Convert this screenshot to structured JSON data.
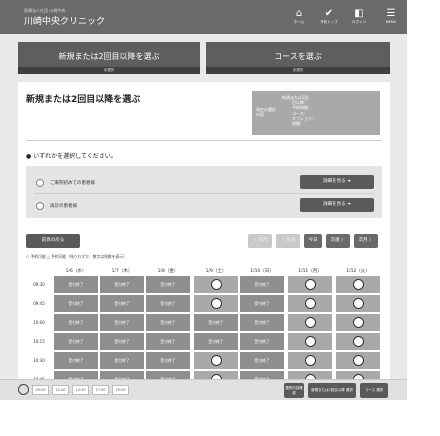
{
  "header": {
    "clinic_sub": "医療法人社団 川崎中央",
    "clinic_name": "川崎中央クリニック",
    "nav": [
      {
        "icon": "home-icon",
        "glyph": "⌂",
        "label": "ホーム"
      },
      {
        "icon": "check-icon",
        "glyph": "✔",
        "label": "予約トップ"
      },
      {
        "icon": "login-icon",
        "glyph": "◧",
        "label": "ログイン"
      },
      {
        "icon": "menu-icon",
        "glyph": "☰",
        "label": "MENU"
      }
    ]
  },
  "steps": [
    {
      "title": "新規または2回目以降を選ぶ",
      "status": "未選択"
    },
    {
      "title": "コースを選ぶ",
      "status": "未選択"
    }
  ],
  "panel": {
    "title": "新規または2回目以降を選ぶ",
    "selection": {
      "heading": "現在の選択内容",
      "rows": [
        "新規または2回",
        "目以降：",
        "予約時間：",
        "コース：",
        "オプション：",
        "総額："
      ]
    },
    "prompt": "● いずれかを選択してください。",
    "options": [
      {
        "label": "ご来院初めての患者様",
        "button": "詳細を見る ➜"
      },
      {
        "label": "再診の患者様",
        "button": "詳細を見る ➜"
      }
    ]
  },
  "toolbar": {
    "back": "前頁の戻る",
    "nav": [
      {
        "label": "〈 前月",
        "enabled": false
      },
      {
        "label": "〈 前週",
        "enabled": false
      },
      {
        "label": "今日",
        "enabled": true
      },
      {
        "label": "次週 〉",
        "enabled": true
      },
      {
        "label": "次月 〉",
        "enabled": true
      }
    ]
  },
  "legend": "○ 予約可能 △ 予約可能（残りわずか、数字は残数を表示）",
  "schedule": {
    "dates": [
      "1/6（水）",
      "1/7（木）",
      "1/8（金）",
      "1/9（土）",
      "1/10（日）",
      "1/11（月）",
      "1/12（火）"
    ],
    "times": [
      "09:30",
      "09:45",
      "10:00",
      "10:15",
      "10:30",
      "10:45"
    ],
    "closed_label": "受付終了",
    "rows": [
      [
        "受付終了",
        "受付終了",
        "受付終了",
        "○",
        "受付終了",
        "○",
        "○"
      ],
      [
        "受付終了",
        "受付終了",
        "受付終了",
        "○",
        "受付終了",
        "○",
        "○"
      ],
      [
        "受付終了",
        "受付終了",
        "受付終了",
        "受付終了",
        "受付終了",
        "○",
        "○"
      ],
      [
        "受付終了",
        "受付終了",
        "受付終了",
        "受付終了",
        "受付終了",
        "○",
        "○"
      ],
      [
        "受付終了",
        "受付終了",
        "受付終了",
        "○",
        "受付終了",
        "○",
        "○"
      ],
      [
        "受付終了",
        "受付終了",
        "受付終了",
        "○",
        "受付終了",
        "○",
        "○"
      ]
    ]
  },
  "bottom": {
    "times": [
      "09:00",
      "12:00",
      "14:30",
      "17:00",
      "19:00"
    ],
    "btn_left": "選択内容確認",
    "btn_mid": "新規または2回目以降 選択",
    "btn_right": "コース 選択"
  }
}
